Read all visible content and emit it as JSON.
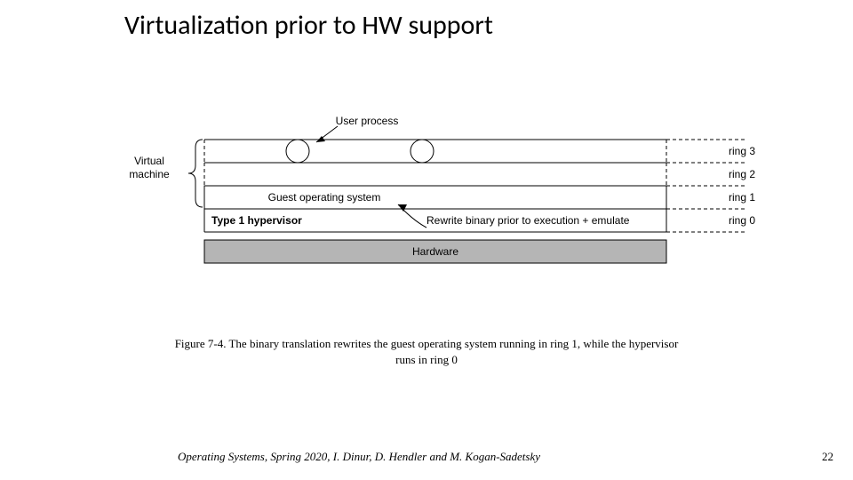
{
  "title": "Virtualization prior to HW support",
  "labels": {
    "user_process": "User process",
    "virtual_machine_l1": "Virtual",
    "virtual_machine_l2": "machine",
    "guest_os": "Guest operating system",
    "type1": "Type 1 hypervisor",
    "rewrite": "Rewrite binary prior to execution + emulate",
    "hardware": "Hardware",
    "ring3": "ring 3",
    "ring2": "ring 2",
    "ring1": "ring 1",
    "ring0": "ring 0"
  },
  "caption": "Figure 7-4. The binary translation rewrites the guest operating system running in ring 1, while the hypervisor runs in ring 0",
  "footer": "Operating Systems, Spring 2020, I. Dinur, D. Hendler and M. Kogan-Sadetsky",
  "page_number": "22"
}
